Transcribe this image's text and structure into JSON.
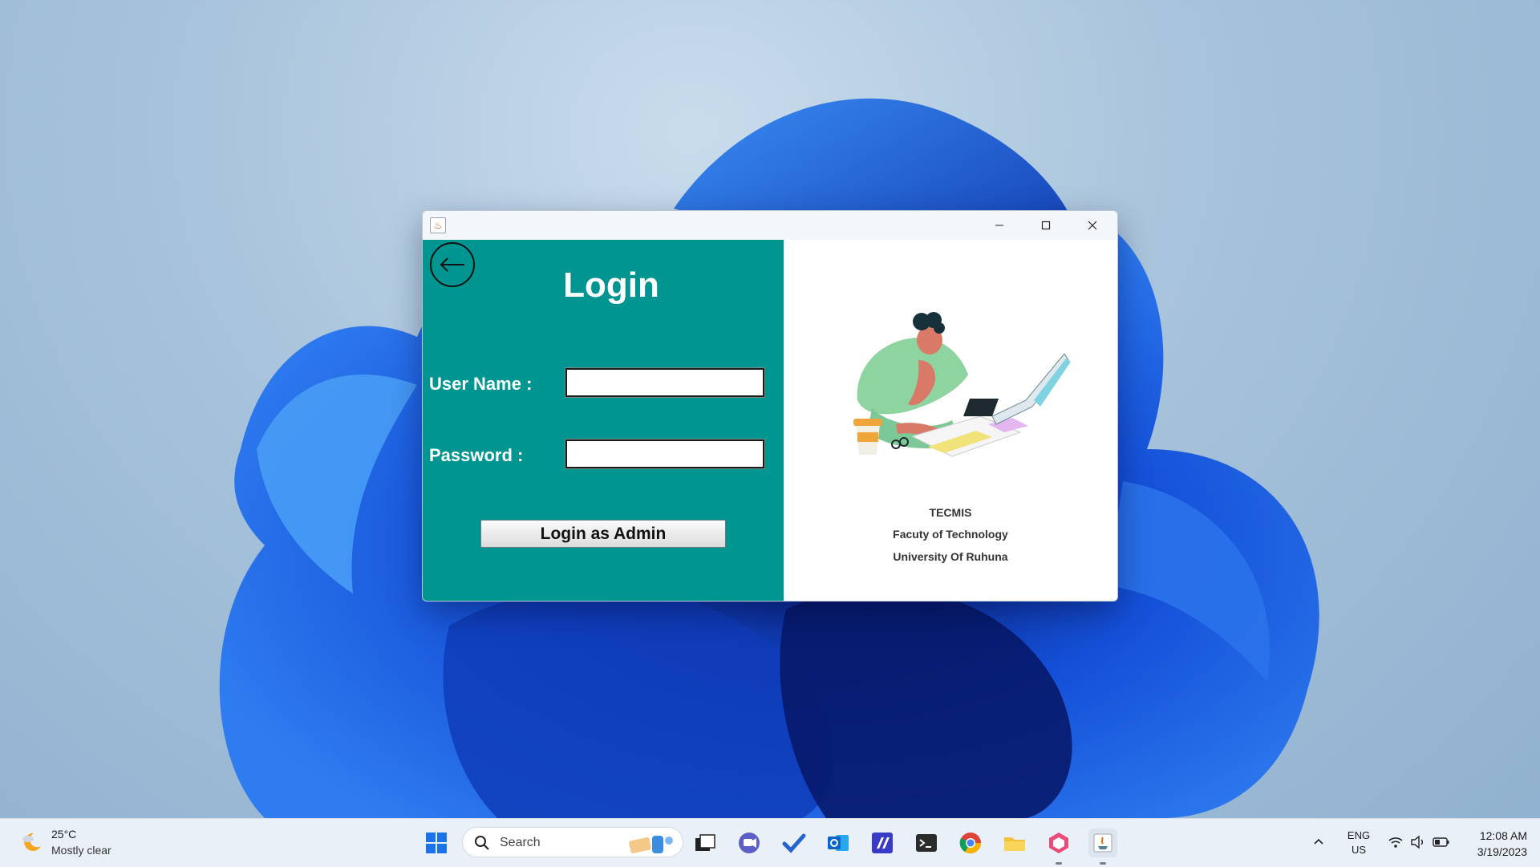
{
  "window": {
    "title": "",
    "controls": {
      "minimize": "minimize",
      "maximize": "maximize",
      "close": "close"
    }
  },
  "login": {
    "title": "Login",
    "username_label": "User Name :",
    "password_label": "Password :",
    "username_value": "",
    "password_value": "",
    "submit_label": "Login as Admin",
    "accent_color": "#009591"
  },
  "info": {
    "line1": "TECMIS",
    "line2": "Facuty of Technology",
    "line3": "University Of Ruhuna"
  },
  "taskbar": {
    "weather": {
      "temp": "25°C",
      "desc": "Mostly clear"
    },
    "search_placeholder": "Search",
    "apps": [
      "start-icon",
      "task-view-icon",
      "chat-icon",
      "todo-icon",
      "outlook-icon",
      "vscode-icon",
      "terminal-icon",
      "chrome-icon",
      "file-explorer-icon",
      "office-hub-icon",
      "java-icon"
    ],
    "language": {
      "line1": "ENG",
      "line2": "US"
    },
    "clock": {
      "time": "12:08 AM",
      "date": "3/19/2023"
    }
  }
}
